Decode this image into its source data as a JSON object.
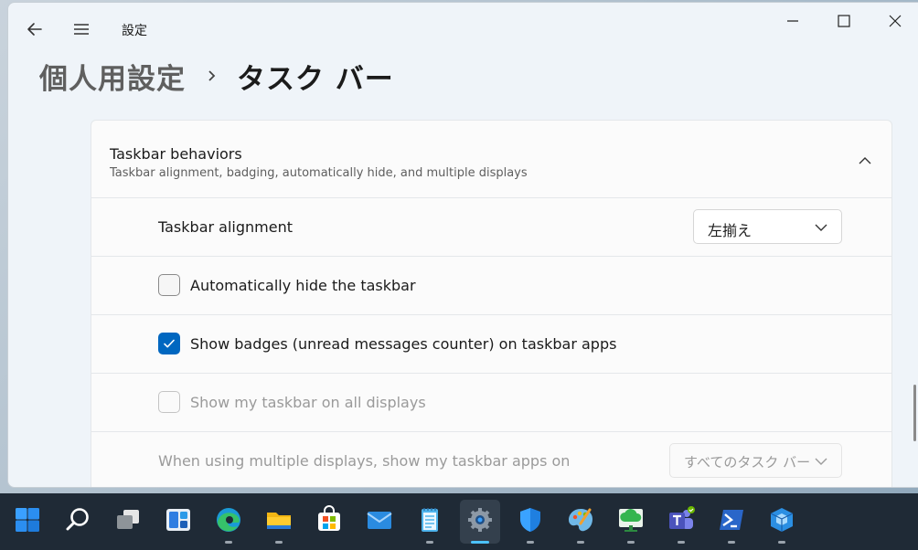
{
  "app": {
    "title": "設定"
  },
  "breadcrumb": {
    "parent": "個人用設定",
    "current": "タスク バー"
  },
  "section": {
    "title": "Taskbar behaviors",
    "subtitle": "Taskbar alignment, badging, automatically hide, and multiple displays",
    "expanded": true
  },
  "settings": {
    "alignment": {
      "label": "Taskbar alignment",
      "value": "左揃え"
    },
    "auto_hide": {
      "label": "Automatically hide the taskbar",
      "checked": false
    },
    "badges": {
      "label": "Show badges (unread messages counter) on taskbar apps",
      "checked": true
    },
    "all_displays": {
      "label": "Show my taskbar on all displays",
      "checked": false,
      "disabled": true
    },
    "multi_display": {
      "label": "When using multiple displays, show my taskbar apps on",
      "value": "すべてのタスク バー",
      "disabled": true
    }
  },
  "colors": {
    "accent": "#0067c0",
    "taskbar": "#1f2a36"
  },
  "taskbar": {
    "items": [
      {
        "icon": "windows-start-icon"
      },
      {
        "icon": "search-icon"
      },
      {
        "icon": "task-view-icon"
      },
      {
        "icon": "widgets-icon"
      },
      {
        "icon": "edge-icon",
        "running": true
      },
      {
        "icon": "file-explorer-icon",
        "running": true
      },
      {
        "icon": "store-icon"
      },
      {
        "icon": "mail-icon"
      },
      {
        "icon": "notepad-icon",
        "running": true
      },
      {
        "icon": "settings-icon",
        "running": true,
        "active": true
      },
      {
        "icon": "security-shield-icon",
        "running": true
      },
      {
        "icon": "paint-icon",
        "running": true
      },
      {
        "icon": "cloud-app-icon",
        "running": true
      },
      {
        "icon": "teams-icon",
        "running": true
      },
      {
        "icon": "powershell-icon",
        "running": true
      },
      {
        "icon": "hyper-v-icon",
        "running": true
      }
    ]
  }
}
